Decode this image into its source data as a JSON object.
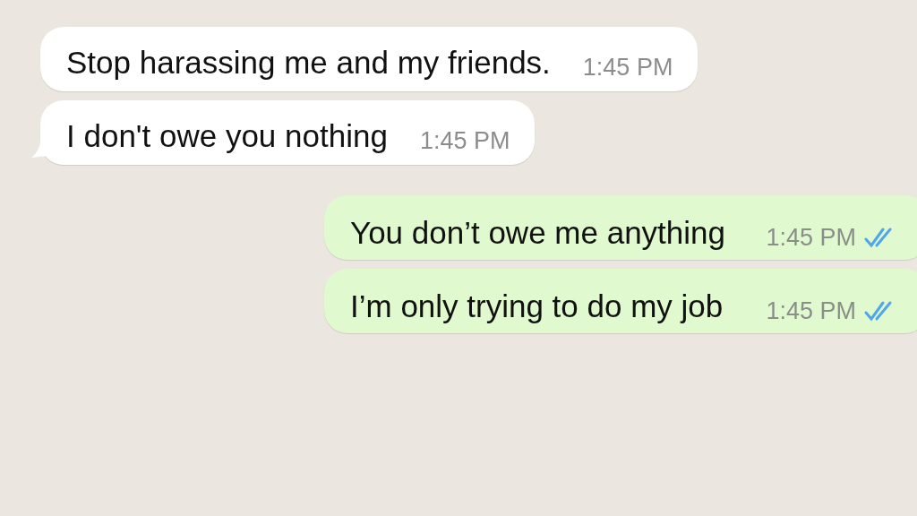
{
  "messages": [
    {
      "kind": "incoming",
      "text": "Stop harassing me and my friends.",
      "time": "1:45 PM",
      "tail": false
    },
    {
      "kind": "incoming",
      "text": "I don't owe you nothing",
      "time": "1:45 PM",
      "tail": true
    },
    {
      "kind": "outgoing",
      "text": "You don’t owe me anything",
      "time": "1:45 PM",
      "read": true
    },
    {
      "kind": "outgoing",
      "text": "I’m only trying to do my job",
      "time": "1:45 PM",
      "read": true
    }
  ]
}
